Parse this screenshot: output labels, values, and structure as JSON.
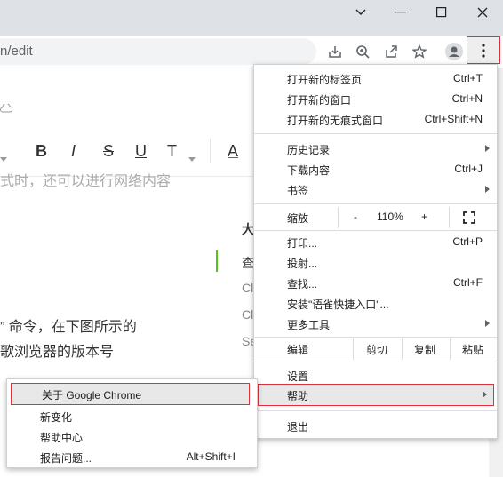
{
  "window": {
    "minimize_icon": "minimize-icon",
    "maximize_icon": "maximize-icon",
    "close_icon": "close-icon",
    "tab_search_icon": "chevron-down-icon"
  },
  "address": {
    "url": "n/edit"
  },
  "toolbar": {
    "icons": [
      "install-icon",
      "zoom-icon",
      "share-icon",
      "star-icon",
      "profile-icon",
      "menu-icon"
    ]
  },
  "editor": {
    "format_buttons": [
      "B",
      "I",
      "S",
      "U",
      "T",
      "A"
    ],
    "text_line1": "式时，还可以进行网络内容",
    "text_line2": "” 命令，在下图所示的",
    "text_line3": "歌浏览器的版本号",
    "side_head": "大",
    "side_items": [
      "查",
      "Cl",
      "Cl",
      "Se"
    ]
  },
  "menu": {
    "new_tab": "打开新的标签页",
    "new_tab_sc": "Ctrl+T",
    "new_window": "打开新的窗口",
    "new_window_sc": "Ctrl+N",
    "incognito": "打开新的无痕式窗口",
    "incognito_sc": "Ctrl+Shift+N",
    "history": "历史记录",
    "downloads": "下载内容",
    "downloads_sc": "Ctrl+J",
    "bookmarks": "书签",
    "zoom": "缩放",
    "zoom_minus": "-",
    "zoom_value": "110%",
    "zoom_plus": "+",
    "print": "打印...",
    "print_sc": "Ctrl+P",
    "cast": "投射...",
    "find": "查找...",
    "find_sc": "Ctrl+F",
    "install": "安装\"语雀快捷入口\"...",
    "more_tools": "更多工具",
    "edit": "编辑",
    "cut": "剪切",
    "copy": "复制",
    "paste": "粘贴",
    "settings": "设置",
    "help": "帮助",
    "exit": "退出"
  },
  "help_menu": {
    "about": "关于 Google Chrome",
    "whats_new": "新变化",
    "help_center": "帮助中心",
    "report": "报告问题...",
    "report_sc": "Alt+Shift+I"
  },
  "colors": {
    "highlight_border": "#e0303a",
    "text_accent": "#e0303a",
    "side_bar": "#52c41a"
  }
}
